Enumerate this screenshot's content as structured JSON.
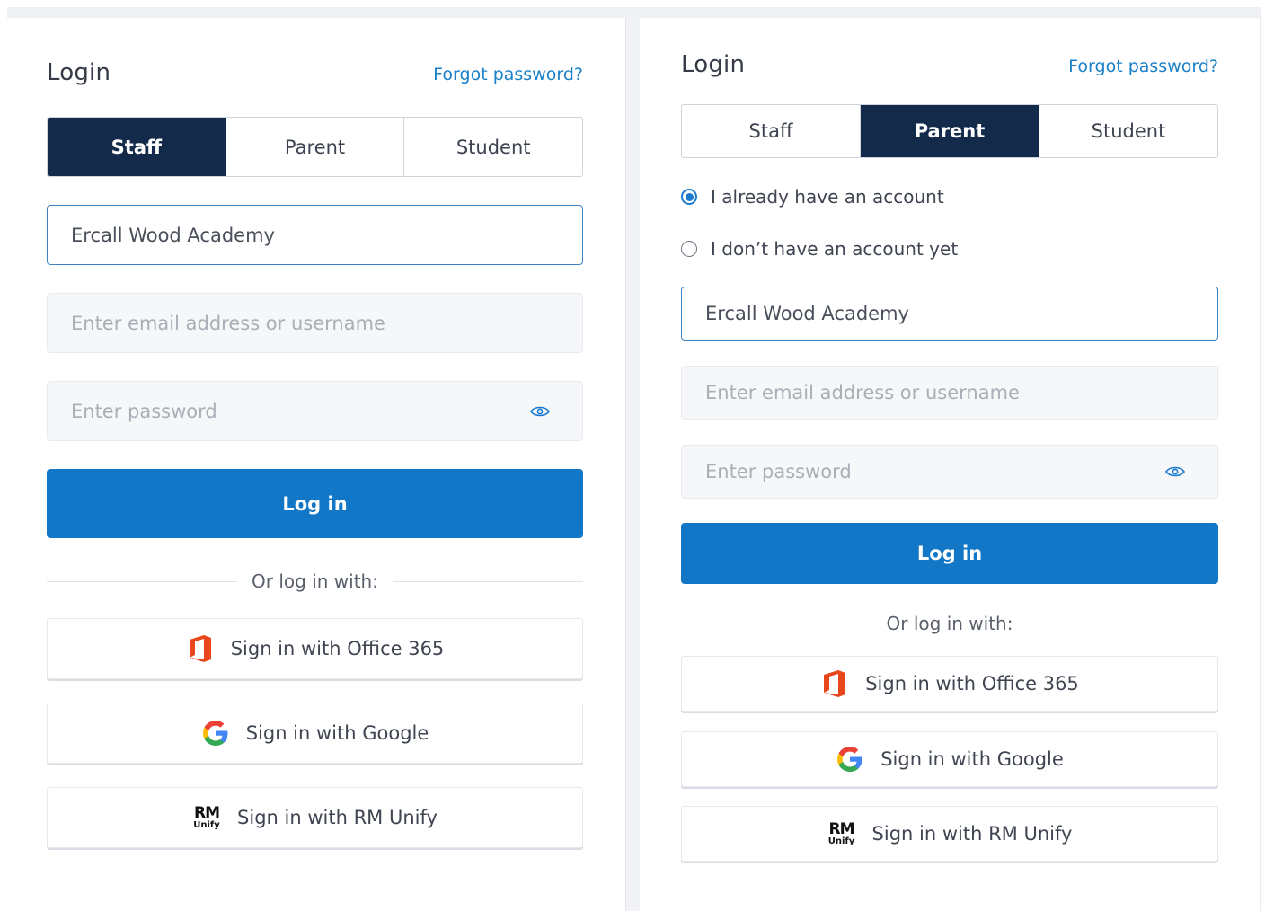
{
  "left": {
    "title": "Login",
    "forgot_label": "Forgot password?",
    "tabs": [
      {
        "label": "Staff",
        "active": true
      },
      {
        "label": "Parent",
        "active": false
      },
      {
        "label": "Student",
        "active": false
      }
    ],
    "school": "Ercall Wood Academy",
    "email_placeholder": "Enter email address or username",
    "password_placeholder": "Enter password",
    "login_label": "Log in",
    "or_text": "Or log in with:",
    "sso": [
      {
        "label": "Sign in with Office 365",
        "icon": "office365-icon"
      },
      {
        "label": "Sign in with Google",
        "icon": "google-icon"
      },
      {
        "label": "Sign in with RM Unify",
        "icon": "rm-unify-icon"
      }
    ]
  },
  "right": {
    "title": "Login",
    "forgot_label": "Forgot password?",
    "tabs": [
      {
        "label": "Staff",
        "active": false
      },
      {
        "label": "Parent",
        "active": true
      },
      {
        "label": "Student",
        "active": false
      }
    ],
    "radio_options": [
      {
        "label": "I already have an account",
        "checked": true
      },
      {
        "label": "I don’t have an account yet",
        "checked": false
      }
    ],
    "school": "Ercall Wood Academy",
    "email_placeholder": "Enter email address or username",
    "password_placeholder": "Enter password",
    "login_label": "Log in",
    "or_text": "Or log in with:",
    "sso": [
      {
        "label": "Sign in with Office 365",
        "icon": "office365-icon"
      },
      {
        "label": "Sign in with Google",
        "icon": "google-icon"
      },
      {
        "label": "Sign in with RM Unify",
        "icon": "rm-unify-icon"
      }
    ]
  },
  "rm_logo": {
    "top": "RM",
    "bottom": "Unify"
  },
  "colors": {
    "active_tab": "#142a4a",
    "primary_button": "#1277c6",
    "link": "#1a80c9",
    "focus_border": "#3b82c5"
  }
}
